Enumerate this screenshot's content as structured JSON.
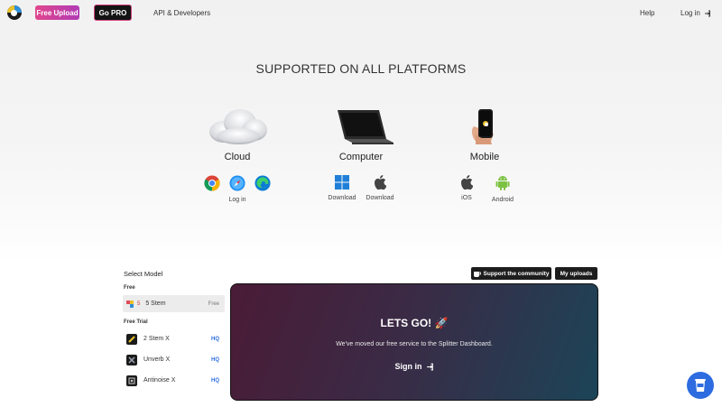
{
  "topbar": {
    "free_upload": "Free Upload",
    "go_pro": "Go PRO",
    "api": "API & Developers",
    "help": "Help",
    "login": "Log in"
  },
  "heading": "SUPPORTED ON ALL PLATFORMS",
  "platforms": {
    "cloud": {
      "title": "Cloud",
      "login": "Log in"
    },
    "computer": {
      "title": "Computer",
      "windows": "Download",
      "mac": "Download"
    },
    "mobile": {
      "title": "Mobile",
      "ios": "iOS",
      "android": "Android"
    }
  },
  "models": {
    "title": "Select Model",
    "free_group": "Free",
    "trial_group": "Free Trial",
    "items": [
      {
        "badge": "5",
        "name": "5 Stem",
        "tag": "Free"
      },
      {
        "name": "2 Stem X",
        "tag": "HQ"
      },
      {
        "name": "Unverb X",
        "tag": "HQ"
      },
      {
        "name": "Antinoise X",
        "tag": "HQ"
      }
    ]
  },
  "actions": {
    "support": "Support the community",
    "uploads": "My uploads"
  },
  "card": {
    "title": "LETS GO! 🚀",
    "subtitle": "We've moved our free service to the Splitter Dashboard.",
    "signin": "Sign in"
  },
  "colors": {
    "accent_pink": "#e0468d",
    "hq_blue": "#2b6fe0",
    "fab_blue": "#2d6ce0"
  },
  "icons": [
    "logo-icon",
    "login-icon",
    "cloud-icon",
    "laptop-icon",
    "phone-icon",
    "chrome-icon",
    "safari-icon",
    "edge-icon",
    "windows-icon",
    "apple-icon",
    "android-icon",
    "coffee-cup-icon"
  ]
}
